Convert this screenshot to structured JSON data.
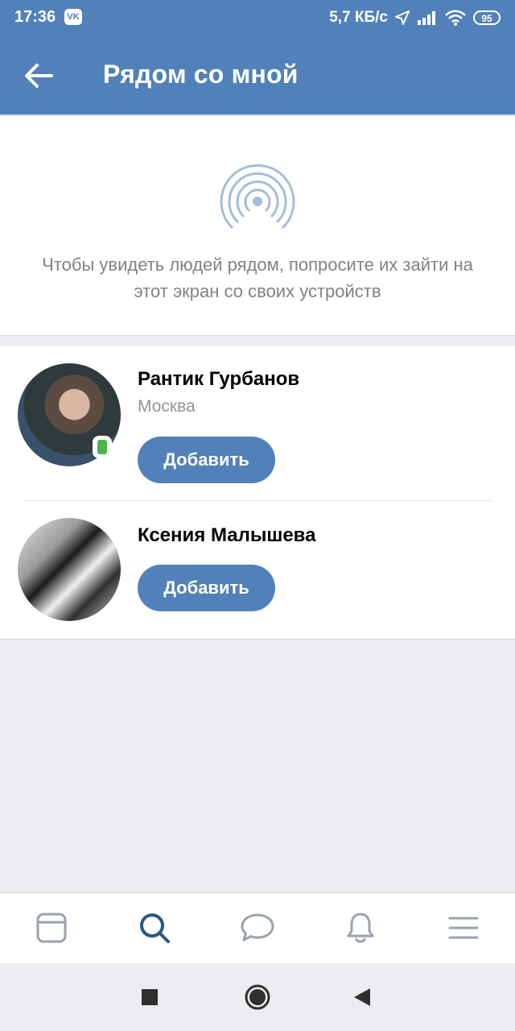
{
  "status_bar": {
    "time": "17:36",
    "app_badge": "VK",
    "network_speed": "5,7 КБ/с",
    "battery": "95",
    "icons": [
      "location-arrow-icon",
      "signal-icon",
      "wifi-icon",
      "battery-icon"
    ]
  },
  "header": {
    "title": "Рядом со мной",
    "back_icon": "arrow-left-icon"
  },
  "nearby": {
    "icon": "radar-icon",
    "hint": "Чтобы увидеть людей рядом, попросите их зайти на этот экран со своих устройств"
  },
  "people": [
    {
      "name": "Рантик Гурбанов",
      "city": "Москва",
      "online_status": "mobile",
      "button_label": "Добавить"
    },
    {
      "name": "Ксения Малышева",
      "city": "",
      "button_label": "Добавить"
    }
  ],
  "tab_bar": {
    "items": [
      "news-icon",
      "search-icon",
      "messages-icon",
      "notifications-icon",
      "menu-icon"
    ],
    "active": "search-icon",
    "active_color": "#2a5885",
    "inactive_color": "#99a2ad"
  },
  "navigation_bar": {
    "items": [
      "recent-apps-icon",
      "home-icon",
      "back-icon"
    ]
  },
  "colors": {
    "primary": "#5181b8",
    "background": "#ebedf0",
    "text_secondary": "#939393"
  }
}
